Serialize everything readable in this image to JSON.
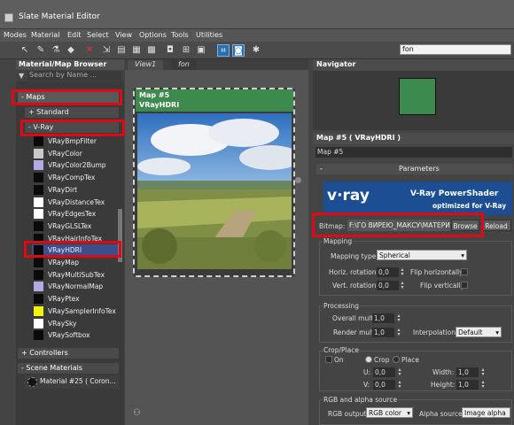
{
  "window": {
    "title": "Slate Material Editor"
  },
  "menu": [
    "Modes",
    "Material",
    "Edit",
    "Select",
    "View",
    "Options",
    "Tools",
    "Utilities"
  ],
  "search_field": {
    "value": "fon"
  },
  "browser": {
    "title": "Material/Map Browser",
    "search_placeholder": "Search by Name ...",
    "maps_label": "- Maps",
    "standard_label": "+ Standard",
    "vray_label": "- V-Ray",
    "items": [
      {
        "label": "VRayBmpFilter",
        "color": "#0a0a0a"
      },
      {
        "label": "VRayColor",
        "color": "#c9c9c9"
      },
      {
        "label": "VRayColor2Bump",
        "color": "#b7a8e6"
      },
      {
        "label": "VRayCompTex",
        "color": "#0a0a0a"
      },
      {
        "label": "VRayDirt",
        "color": "#0a0a0a"
      },
      {
        "label": "VRayDistanceTex",
        "color": "#ffffff"
      },
      {
        "label": "VRayEdgesTex",
        "color": "#ffffff"
      },
      {
        "label": "VRayGLSLTex",
        "color": "#0a0a0a"
      },
      {
        "label": "VRayHairInfoTex",
        "color": "#0a0a0a"
      },
      {
        "label": "VRayHDRI",
        "color": "#0a0a0a"
      },
      {
        "label": "VRayMap",
        "color": "#0a0a0a"
      },
      {
        "label": "VRayMultiSubTex",
        "color": "#0a0a0a"
      },
      {
        "label": "VRayNormalMap",
        "color": "#b7a8e6"
      },
      {
        "label": "VRayPtex",
        "color": "#0a0a0a"
      },
      {
        "label": "VRaySamplerInfoTex",
        "color": "#f2f20a"
      },
      {
        "label": "VRaySky",
        "color": "#ffffff"
      },
      {
        "label": "VRaySoftbox",
        "color": "#0a0a0a"
      }
    ],
    "controllers_label": "+ Controllers",
    "scene_label": "- Scene Materials",
    "scene_item": "Material #25 ( Coron..."
  },
  "view": {
    "tabs": [
      "View1",
      "fon"
    ],
    "node_title": "Map #5",
    "node_subtitle": "VRayHDRI"
  },
  "navigator": {
    "title": "Navigator"
  },
  "params": {
    "header": "Map #5  ( VRayHDRI )",
    "name_field": "Map #5",
    "rollout": "Parameters",
    "vray_logo": "v·ray",
    "vray_title": "V-Ray PowerShader",
    "vray_sub": "optimized for V-Ray",
    "bitmap_label": "Bitmap:",
    "bitmap_path": "F:\\ГО ВИРЕЮ_МАКСУ\\МАТЕРИАЛ",
    "browse_label": "Browse",
    "reload_label": "Reload",
    "mapping_section": "Mapping",
    "mapping_type_label": "Mapping type:",
    "mapping_type": "Spherical",
    "horiz_label": "Horiz. rotation:",
    "horiz_value": "0,0",
    "vert_label": "Vert. rotation:",
    "vert_value": "0,0",
    "flip_h_label": "Flip horizontally",
    "flip_v_label": "Flip vertically",
    "processing_section": "Processing",
    "overall_label": "Overall mult:",
    "overall_value": "1,0",
    "render_label": "Render mult:",
    "render_value": "1,0",
    "interp_label": "Interpolation:",
    "interp_value": "Default",
    "crop_section": "Crop/Place",
    "on_label": "On",
    "crop_label": "Crop",
    "place_label": "Place",
    "u_label": "U:",
    "u_value": "0,0",
    "v_label": "V:",
    "v_value": "0,0",
    "width_label": "Width:",
    "width_value": "1,0",
    "height_label": "Height:",
    "height_value": "1,0",
    "rgb_section": "RGB and alpha source",
    "rgb_output_label": "RGB output:",
    "rgb_output_value": "RGB color",
    "alpha_source_label": "Alpha source:",
    "alpha_source_value": "Image alpha"
  },
  "accent": {
    "node_green": "#3d8a4e",
    "highlight_red": "#e00814",
    "selection_blue": "#3c4f8a"
  }
}
